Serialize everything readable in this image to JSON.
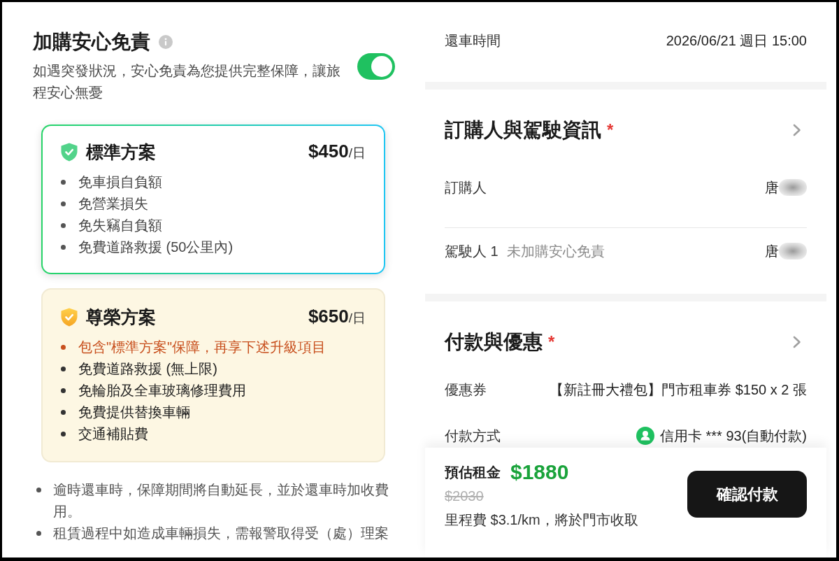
{
  "insurance": {
    "title": "加購安心免責",
    "description": "如遇突發狀況，安心免責為您提供完整保障，讓旅程安心無憂",
    "enabled": true,
    "plans": [
      {
        "kind": "standard",
        "name": "標準方案",
        "price": "$450",
        "unit": "/日",
        "selected": true,
        "features": [
          {
            "text": "免車損自負額",
            "highlight": false
          },
          {
            "text": "免營業損失",
            "highlight": false
          },
          {
            "text": "免失竊自負額",
            "highlight": false
          },
          {
            "text": "免費道路救援 (50公里內)",
            "highlight": false
          }
        ]
      },
      {
        "kind": "premium",
        "name": "尊榮方案",
        "price": "$650",
        "unit": "/日",
        "selected": false,
        "features": [
          {
            "text": "包含\"標準方案\"保障，再享下述升級項目",
            "highlight": true
          },
          {
            "text": "免費道路救援 (無上限)",
            "highlight": false
          },
          {
            "text": "免輪胎及全車玻璃修理費用",
            "highlight": false
          },
          {
            "text": "免費提供替換車輛",
            "highlight": false
          },
          {
            "text": "交通補貼費",
            "highlight": false
          }
        ]
      }
    ],
    "notes": [
      "逾時還車時，保障期間將自動延長，並於還車時加收費用。",
      "租賃過程中如造成車輛損失，需報警取得受（處）理案"
    ]
  },
  "summary": {
    "return_time": {
      "label": "還車時間",
      "value": "2026/06/21 週日 15:00"
    },
    "sections": [
      {
        "title": "訂購人與駕駛資訊",
        "required_mark": "*",
        "rows": [
          {
            "kind": "name",
            "label": "訂購人",
            "value": "唐"
          },
          {
            "kind": "name",
            "label": "駕駛人 1",
            "note": "未加購安心免責",
            "value": "唐"
          }
        ]
      },
      {
        "title": "付款與優惠",
        "required_mark": "*",
        "rows": [
          {
            "kind": "text",
            "label": "優惠券",
            "value": "【新註冊大禮包】門市租車券 $150 x 2 張"
          },
          {
            "kind": "payment",
            "label": "付款方式",
            "value": "信用卡 *** 93(自動付款)"
          }
        ]
      }
    ]
  },
  "checkout": {
    "label": "預估租金",
    "price": "$1880",
    "original_price": "$2030",
    "mileage_note": "里程費 $3.1/km，將於門市收取",
    "confirm_button": "確認付款"
  }
}
